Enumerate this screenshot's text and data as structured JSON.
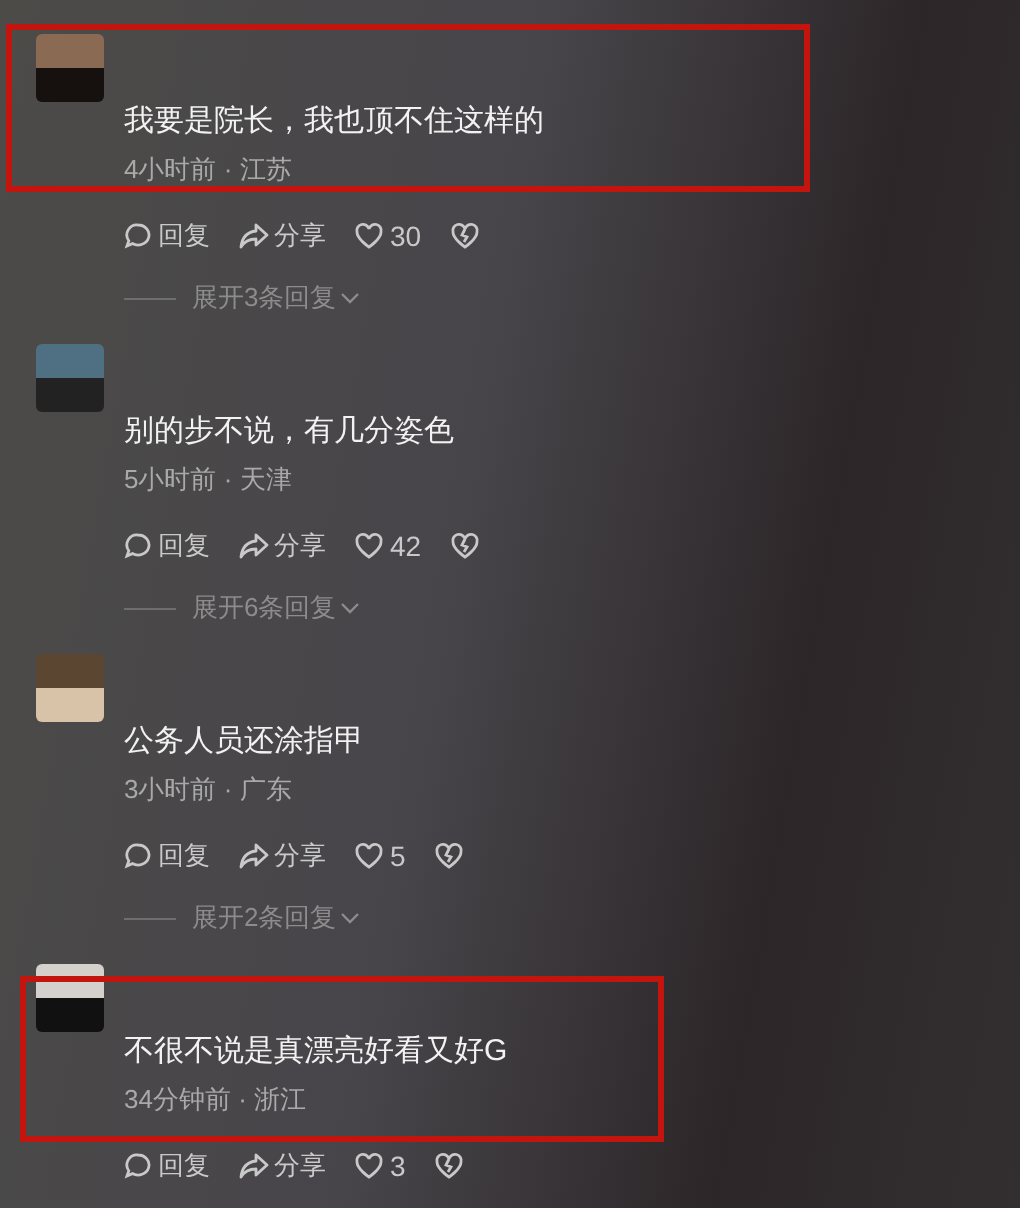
{
  "comments": [
    {
      "text": "我要是院长，我也顶不住这样的",
      "time": "4小时前",
      "separator": "·",
      "location": "江苏",
      "highlighted": true,
      "actions": {
        "reply": "回复",
        "share": "分享",
        "likes": "30"
      },
      "expand": "展开3条回复"
    },
    {
      "text": "别的步不说，有几分姿色",
      "time": "5小时前",
      "separator": "·",
      "location": "天津",
      "highlighted": false,
      "actions": {
        "reply": "回复",
        "share": "分享",
        "likes": "42"
      },
      "expand": "展开6条回复"
    },
    {
      "text": "公务人员还涂指甲",
      "time": "3小时前",
      "separator": "·",
      "location": "广东",
      "highlighted": false,
      "actions": {
        "reply": "回复",
        "share": "分享",
        "likes": "5"
      },
      "expand": "展开2条回复"
    },
    {
      "text": "不很不说是真漂亮好看又好G",
      "time": "34分钟前",
      "separator": "·",
      "location": "浙江",
      "highlighted": true,
      "actions": {
        "reply": "回复",
        "share": "分享",
        "likes": "3"
      }
    }
  ]
}
